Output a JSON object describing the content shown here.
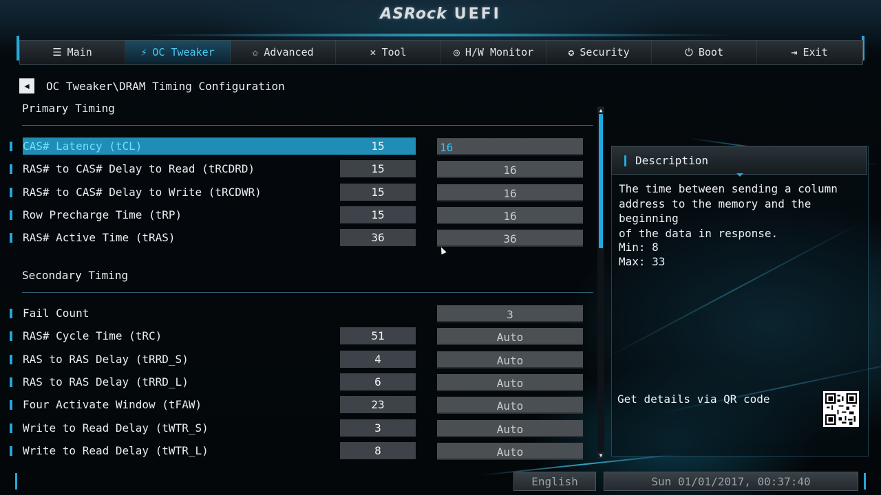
{
  "header": {
    "brand": "ASRock",
    "product": "UEFI"
  },
  "tabs": [
    {
      "label": "Main",
      "icon": "list-icon",
      "active": false
    },
    {
      "label": "OC Tweaker",
      "icon": "rocket-icon",
      "active": true
    },
    {
      "label": "Advanced",
      "icon": "star-icon",
      "active": false
    },
    {
      "label": "Tool",
      "icon": "wrench-icon",
      "active": false
    },
    {
      "label": "H/W Monitor",
      "icon": "monitor-icon",
      "active": false
    },
    {
      "label": "Security",
      "icon": "shield-icon",
      "active": false
    },
    {
      "label": "Boot",
      "icon": "power-icon",
      "active": false
    },
    {
      "label": "Exit",
      "icon": "exit-icon",
      "active": false
    }
  ],
  "breadcrumb": "OC Tweaker\\DRAM Timing Configuration",
  "sections": {
    "primary": "Primary Timing",
    "secondary": "Secondary Timing"
  },
  "primary_rows": [
    {
      "label": "CAS# Latency (tCL)",
      "current": "15",
      "value": "16",
      "selected": true
    },
    {
      "label": "RAS# to CAS# Delay to Read  (tRCDRD)",
      "current": "15",
      "value": "16"
    },
    {
      "label": "RAS# to CAS# Delay to Write (tRCDWR)",
      "current": "15",
      "value": "16"
    },
    {
      "label": "Row Precharge Time (tRP)",
      "current": "15",
      "value": "16"
    },
    {
      "label": "RAS# Active Time (tRAS)",
      "current": "36",
      "value": "36"
    }
  ],
  "secondary_rows": [
    {
      "label": "Fail Count",
      "current": "",
      "value": "3"
    },
    {
      "label": "RAS# Cycle Time (tRC)",
      "current": "51",
      "value": "Auto"
    },
    {
      "label": "RAS to RAS Delay (tRRD_S)",
      "current": "4",
      "value": "Auto"
    },
    {
      "label": "RAS to RAS Delay (tRRD_L)",
      "current": "6",
      "value": "Auto"
    },
    {
      "label": "Four Activate Window (tFAW)",
      "current": "23",
      "value": "Auto"
    },
    {
      "label": "Write to Read Delay (tWTR_S)",
      "current": "3",
      "value": "Auto"
    },
    {
      "label": "Write to Read Delay (tWTR_L)",
      "current": "8",
      "value": "Auto"
    }
  ],
  "description": {
    "title": "Description",
    "text": "The time between sending a column\naddress to the memory and the beginning\nof the data in response.",
    "min": "Min: 8",
    "max": "Max: 33",
    "qr_label": "Get details via QR code"
  },
  "footer": {
    "language": "English",
    "datetime": "Sun 01/01/2017, 00:37:40"
  },
  "colors": {
    "accent": "#2aa6d8",
    "selected_row": "#1f8db6",
    "selected_text": "#2fc6f2"
  }
}
